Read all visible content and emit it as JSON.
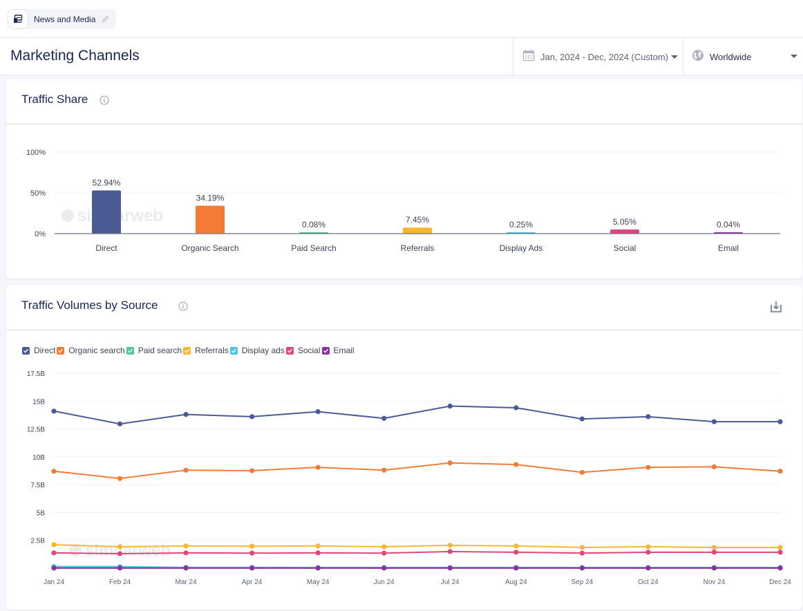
{
  "topbar": {
    "category_label": "News and Media",
    "category_icon": "devices-icon",
    "edit_icon": "pencil-icon"
  },
  "header": {
    "title": "Marketing Channels",
    "date_range": "Jan, 2024 - Dec, 2024 (Custom)",
    "date_icon": "calendar-icon",
    "geo": "Worldwide",
    "geo_icon": "globe-icon"
  },
  "colors": {
    "direct": "#4a5a93",
    "organic": "#f47b35",
    "paid": "#4fc59a",
    "referrals": "#f7b731",
    "display": "#4cc3e2",
    "social": "#e0467a",
    "email": "#8c2fa3"
  },
  "traffic_share": {
    "title": "Traffic Share",
    "watermark": "similarweb"
  },
  "traffic_volumes": {
    "title": "Traffic Volumes by Source",
    "watermark": "similarweb"
  },
  "chart_data": [
    {
      "type": "bar",
      "title": "Traffic Share",
      "categories": [
        "Direct",
        "Organic Search",
        "Paid Search",
        "Referrals",
        "Display Ads",
        "Social",
        "Email"
      ],
      "values": [
        52.94,
        34.19,
        0.08,
        7.45,
        0.25,
        5.05,
        0.04
      ],
      "data_labels": [
        "52.94%",
        "34.19%",
        "0.08%",
        "7.45%",
        "0.25%",
        "5.05%",
        "0.04%"
      ],
      "yticks": [
        "0%",
        "50%",
        "100%"
      ],
      "ylim": [
        0,
        100
      ],
      "xlabel": "",
      "ylabel": "",
      "grid": true
    },
    {
      "type": "line",
      "title": "Traffic Volumes by Source",
      "x": [
        "Jan 24",
        "Feb 24",
        "Mar 24",
        "Apr 24",
        "May 24",
        "Jun 24",
        "Jul 24",
        "Aug 24",
        "Sep 24",
        "Oct 24",
        "Nov 24",
        "Dec 24"
      ],
      "yticks": [
        "2.5B",
        "5B",
        "7.5B",
        "10B",
        "12.5B",
        "15B",
        "17.5B"
      ],
      "ylim": [
        0,
        17.5
      ],
      "yunit": "B",
      "grid": true,
      "legend_position": "top-left",
      "series": [
        {
          "name": "Direct",
          "key": "direct",
          "values": [
            14.1,
            12.95,
            13.8,
            13.6,
            14.05,
            13.45,
            14.55,
            14.4,
            13.4,
            13.6,
            13.15,
            13.15
          ]
        },
        {
          "name": "Organic search",
          "key": "organic",
          "values": [
            8.7,
            8.05,
            8.8,
            8.75,
            9.05,
            8.8,
            9.45,
            9.3,
            8.6,
            9.05,
            9.1,
            8.7
          ]
        },
        {
          "name": "Paid search",
          "key": "paid",
          "values": [
            0.02,
            0.02,
            0.02,
            0.02,
            0.02,
            0.02,
            0.02,
            0.02,
            0.02,
            0.02,
            0.02,
            0.02
          ]
        },
        {
          "name": "Referrals",
          "key": "referrals",
          "values": [
            2.1,
            1.92,
            1.99,
            1.97,
            1.99,
            1.92,
            2.05,
            1.99,
            1.86,
            1.92,
            1.86,
            1.86
          ]
        },
        {
          "name": "Display ads",
          "key": "display",
          "values": [
            0.15,
            0.14,
            0.07,
            0.07,
            0.06,
            0.06,
            0.06,
            0.06,
            0.06,
            0.06,
            0.06,
            0.06
          ]
        },
        {
          "name": "Social",
          "key": "social",
          "values": [
            1.37,
            1.3,
            1.37,
            1.35,
            1.37,
            1.35,
            1.49,
            1.43,
            1.35,
            1.43,
            1.43,
            1.43
          ]
        },
        {
          "name": "Email",
          "key": "email",
          "values": [
            0.01,
            0.01,
            0.01,
            0.01,
            0.01,
            0.01,
            0.01,
            0.01,
            0.01,
            0.01,
            0.01,
            0.01
          ]
        }
      ]
    }
  ]
}
